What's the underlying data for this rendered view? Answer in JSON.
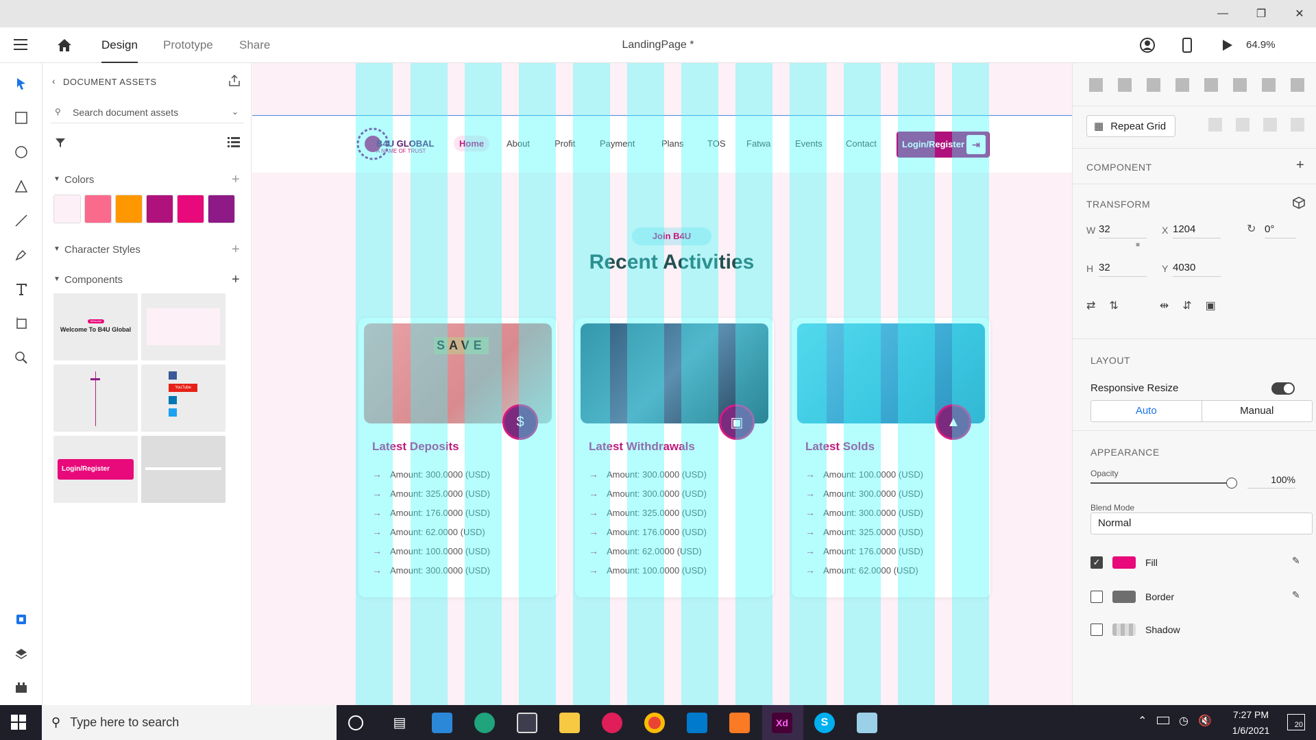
{
  "window": {
    "title": "LandingPage *",
    "zoom": "64.9%"
  },
  "tabs": [
    {
      "label": "Design"
    },
    {
      "label": "Prototype"
    },
    {
      "label": "Share"
    }
  ],
  "assets": {
    "header": "DOCUMENT ASSETS",
    "search_placeholder": "Search document assets",
    "colors_label": "Colors",
    "colors": [
      "#fdf0f6",
      "#fa6a8c",
      "#ff9800",
      "#b0127c",
      "#e8097a",
      "#8e1a87"
    ],
    "char_styles_label": "Character Styles",
    "components_label": "Components",
    "component_thumb_1": {
      "badge": "Welcome",
      "title": "Welcome To B4U Global"
    },
    "component_thumb_5": {
      "label": "Login/Register"
    },
    "social": [
      "YouTube"
    ]
  },
  "canvas": {
    "logo": {
      "title": "B4U GLOBAL",
      "tagline": "A NAME OF TRUST"
    },
    "nav": [
      "Home",
      "About",
      "Profit",
      "Payment",
      "Plans",
      "TOS",
      "Fatwa",
      "Events",
      "Contact"
    ],
    "login_button": "Login/Register",
    "pill": "Join B4U",
    "heading": "Recent Activities",
    "cards": [
      {
        "title": "Latest Deposits",
        "image_text": "SAVE",
        "icon": "money-bag-icon",
        "amounts": [
          "Amount: 300.0000 (USD)",
          "Amount: 325.0000 (USD)",
          "Amount: 176.0000 (USD)",
          "Amount: 62.0000 (USD)",
          "Amount: 100.0000 (USD)",
          "Amount: 300.0000 (USD)"
        ]
      },
      {
        "title": "Latest Withdrawals",
        "icon": "cash-withdraw-icon",
        "amounts": [
          "Amount: 300.0000 (USD)",
          "Amount: 300.0000 (USD)",
          "Amount: 325.0000 (USD)",
          "Amount: 176.0000 (USD)",
          "Amount: 62.0000 (USD)",
          "Amount: 100.0000 (USD)"
        ]
      },
      {
        "title": "Latest Solds",
        "icon": "growth-chart-icon",
        "amounts": [
          "Amount: 100.0000 (USD)",
          "Amount: 300.0000 (USD)",
          "Amount: 300.0000 (USD)",
          "Amount: 325.0000 (USD)",
          "Amount: 176.0000 (USD)",
          "Amount: 62.0000 (USD)"
        ]
      }
    ]
  },
  "props": {
    "repeat_grid": "Repeat Grid",
    "component_label": "COMPONENT",
    "transform_label": "TRANSFORM",
    "w_label": "W",
    "w": "32",
    "h_label": "H",
    "h": "32",
    "x_label": "X",
    "x": "1204",
    "y_label": "Y",
    "y": "4030",
    "rotation": "0°",
    "layout_label": "LAYOUT",
    "responsive_resize": "Responsive Resize",
    "auto": "Auto",
    "manual": "Manual",
    "appearance_label": "APPEARANCE",
    "opacity_label": "Opacity",
    "opacity": "100%",
    "blend_label": "Blend Mode",
    "blend": "Normal",
    "fill_label": "Fill",
    "fill_color": "#e8097a",
    "border_label": "Border",
    "shadow_label": "Shadow"
  },
  "taskbar": {
    "search_placeholder": "Type here to search",
    "time": "7:27 PM",
    "date": "1/6/2021",
    "notifications": "20"
  }
}
